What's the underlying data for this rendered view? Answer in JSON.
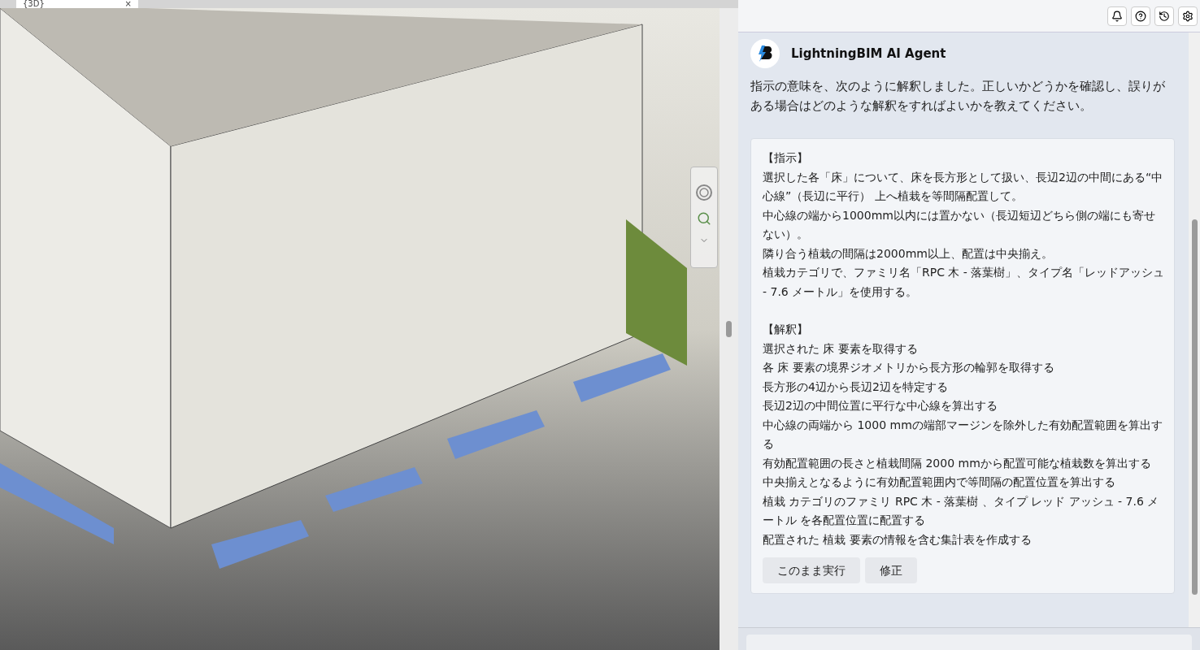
{
  "viewport": {
    "tab": {
      "label": "{3D}",
      "close": "×"
    }
  },
  "panel": {
    "toolbar": [
      {
        "kind": "bell"
      },
      {
        "kind": "help"
      },
      {
        "kind": "history"
      },
      {
        "kind": "settings"
      }
    ]
  },
  "message": {
    "sender": "LightningBIM AI Agent",
    "intro": "指示の意味を、次のように解釈しました。正しいかどうかを確認し、誤りがある場合はどのような解釈をすればよいかを教えてください。",
    "sections": [
      {
        "heading": "【指示】",
        "lines": [
          "選択した各「床」について、床を長方形として扱い、長辺2辺の中間にある“中心線”（長辺に平行） 上へ植栽を等間隔配置して。",
          "中心線の端から1000mm以内には置かない（長辺短辺どちら側の端にも寄せない）。",
          "隣り合う植栽の間隔は2000mm以上、配置は中央揃え。",
          "植栽カテゴリで、ファミリ名「RPC 木 - 落葉樹」、タイプ名「レッドアッシュ - 7.6 メートル」を使用する。"
        ]
      },
      {
        "heading": "【解釈】",
        "lines": [
          "選択された 床 要素を取得する",
          "各 床 要素の境界ジオメトリから長方形の輪郭を取得する",
          "長方形の4辺から長辺2辺を特定する",
          "長辺2辺の中間位置に平行な中心線を算出する",
          "中心線の両端から 1000 mmの端部マージンを除外した有効配置範囲を算出する",
          "有効配置範囲の長さと植栽間隔 2000 mmから配置可能な植栽数を算出する",
          "中央揃えとなるように有効配置範囲内で等間隔の配置位置を算出する",
          "植栽 カテゴリのファミリ RPC 木 - 落葉樹 、タイプ レッド アッシュ - 7.6 メートル を各配置位置に配置する",
          "配置された 植栽 要素の情報を含む集計表を作成する"
        ]
      }
    ],
    "buttons": [
      "このまま実行",
      "修正"
    ]
  }
}
